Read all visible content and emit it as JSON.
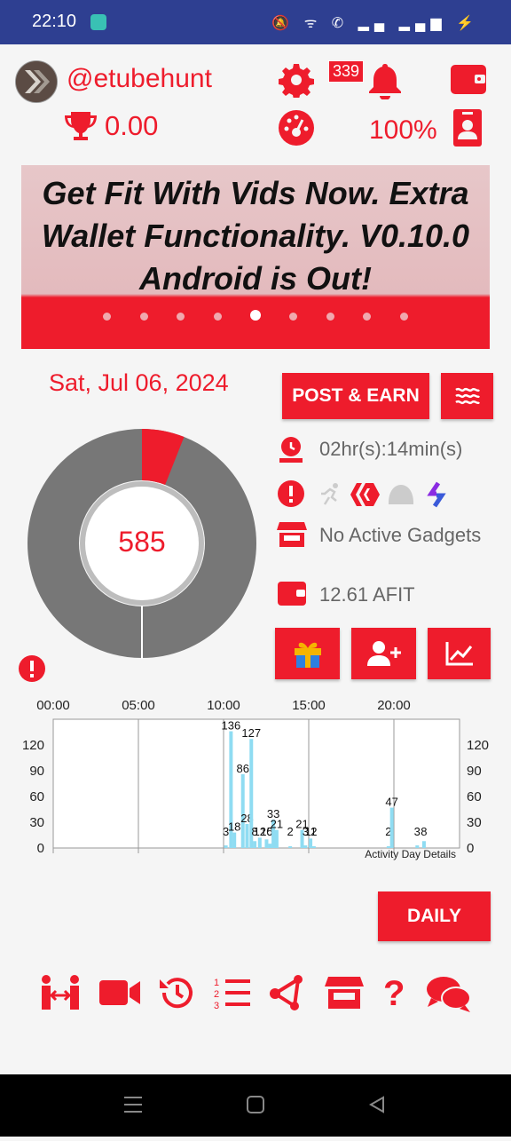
{
  "status_bar": {
    "time": "22:10",
    "icons": "🔕 ᯤ ✆ ▂▄ ▂▄▆ ⚡"
  },
  "header": {
    "username": "@etubehunt",
    "notification_count": "339",
    "balance": "0.00",
    "percent": "100%"
  },
  "banner": {
    "title": "Get Fit With Vids Now. Extra Wallet Functionality. V0.10.0 Android is Out!",
    "slide_count": 9,
    "active_slide": 5
  },
  "activity": {
    "date": "Sat, Jul 06, 2024",
    "post_earn_label": "POST & EARN",
    "score": "585",
    "score_fraction": 0.06,
    "time_active": "02hr(s):14min(s)",
    "gadgets": "No Active Gadgets",
    "afit": "12.61 AFIT",
    "daily_label": "DAILY"
  },
  "colors": {
    "accent": "#ee1c2c",
    "header_bg": "#2e3f91",
    "bar": "#8fdcf2",
    "donut_gray": "#777777"
  },
  "chart_data": {
    "type": "bar",
    "x_tick_labels": [
      "00:00",
      "05:00",
      "10:00",
      "15:00",
      "20:00"
    ],
    "y_ticks": [
      0,
      30,
      60,
      90,
      120
    ],
    "ylim": [
      0,
      150
    ],
    "x_range_hours": [
      0,
      24
    ],
    "annotation": "Activity Day Details",
    "bars": [
      {
        "hour": 10.2,
        "value": 3
      },
      {
        "hour": 10.5,
        "value": 136
      },
      {
        "hour": 10.7,
        "value": 18
      },
      {
        "hour": 11.2,
        "value": 86
      },
      {
        "hour": 11.45,
        "value": 28
      },
      {
        "hour": 11.7,
        "value": 127
      },
      {
        "hour": 11.9,
        "value": 8
      },
      {
        "hour": 12.2,
        "value": 12
      },
      {
        "hour": 12.6,
        "value": 10
      },
      {
        "hour": 12.8,
        "value": 5
      },
      {
        "hour": 13.0,
        "value": 33
      },
      {
        "hour": 13.2,
        "value": 21
      },
      {
        "hour": 14.0,
        "value": 2
      },
      {
        "hour": 14.7,
        "value": 21
      },
      {
        "hour": 14.9,
        "value": 3
      },
      {
        "hour": 15.2,
        "value": 11
      },
      {
        "hour": 15.4,
        "value": 2
      },
      {
        "hour": 19.8,
        "value": 2
      },
      {
        "hour": 20.0,
        "value": 47
      },
      {
        "hour": 21.5,
        "value": 3
      },
      {
        "hour": 21.9,
        "value": 8
      }
    ]
  }
}
